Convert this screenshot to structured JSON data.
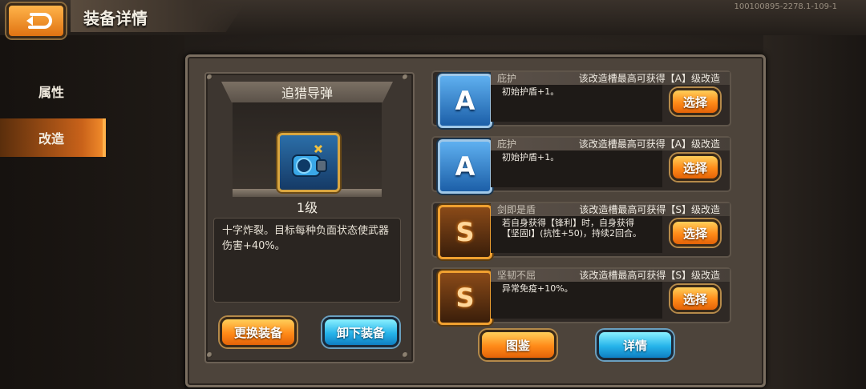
{
  "header": {
    "title": "装备详情",
    "version": "100100895-2278.1-109-1"
  },
  "sidebar": {
    "tabs": [
      {
        "label": "属性"
      },
      {
        "label": "改造"
      }
    ],
    "active_tab": "改造"
  },
  "equipment": {
    "name": "追猎导弹",
    "level": "1级",
    "description": "十字炸裂。目标每种负面状态使武器伤害+40%。",
    "replace_label": "更换装备",
    "unequip_label": "卸下装备"
  },
  "slots": [
    {
      "grade": "A",
      "name": "庇护",
      "limit": "该改造槽最高可获得【A】级改造",
      "effect": "初始护盾+1。",
      "select_label": "选择"
    },
    {
      "grade": "A",
      "name": "庇护",
      "limit": "该改造槽最高可获得【A】级改造",
      "effect": "初始护盾+1。",
      "select_label": "选择"
    },
    {
      "grade": "S",
      "name": "剑即是盾",
      "limit": "该改造槽最高可获得【S】级改造",
      "effect": "若自身获得【锋利】时，自身获得【坚固Ⅰ】(抗性+50)，持续2回合。",
      "select_label": "选择"
    },
    {
      "grade": "S",
      "name": "坚韧不屈",
      "limit": "该改造槽最高可获得【S】级改造",
      "effect": "异常免疫+10%。",
      "select_label": "选择"
    }
  ],
  "footer": {
    "catalog_label": "图鉴",
    "details_label": "详情"
  },
  "icons": {
    "back": "back-arrow-icon",
    "item": "missile-launcher-icon"
  },
  "colors": {
    "accent_orange": "#ff8a18",
    "accent_blue": "#26b4ea",
    "badge_a": "#1c5fa8",
    "badge_s": "#f0a030"
  }
}
